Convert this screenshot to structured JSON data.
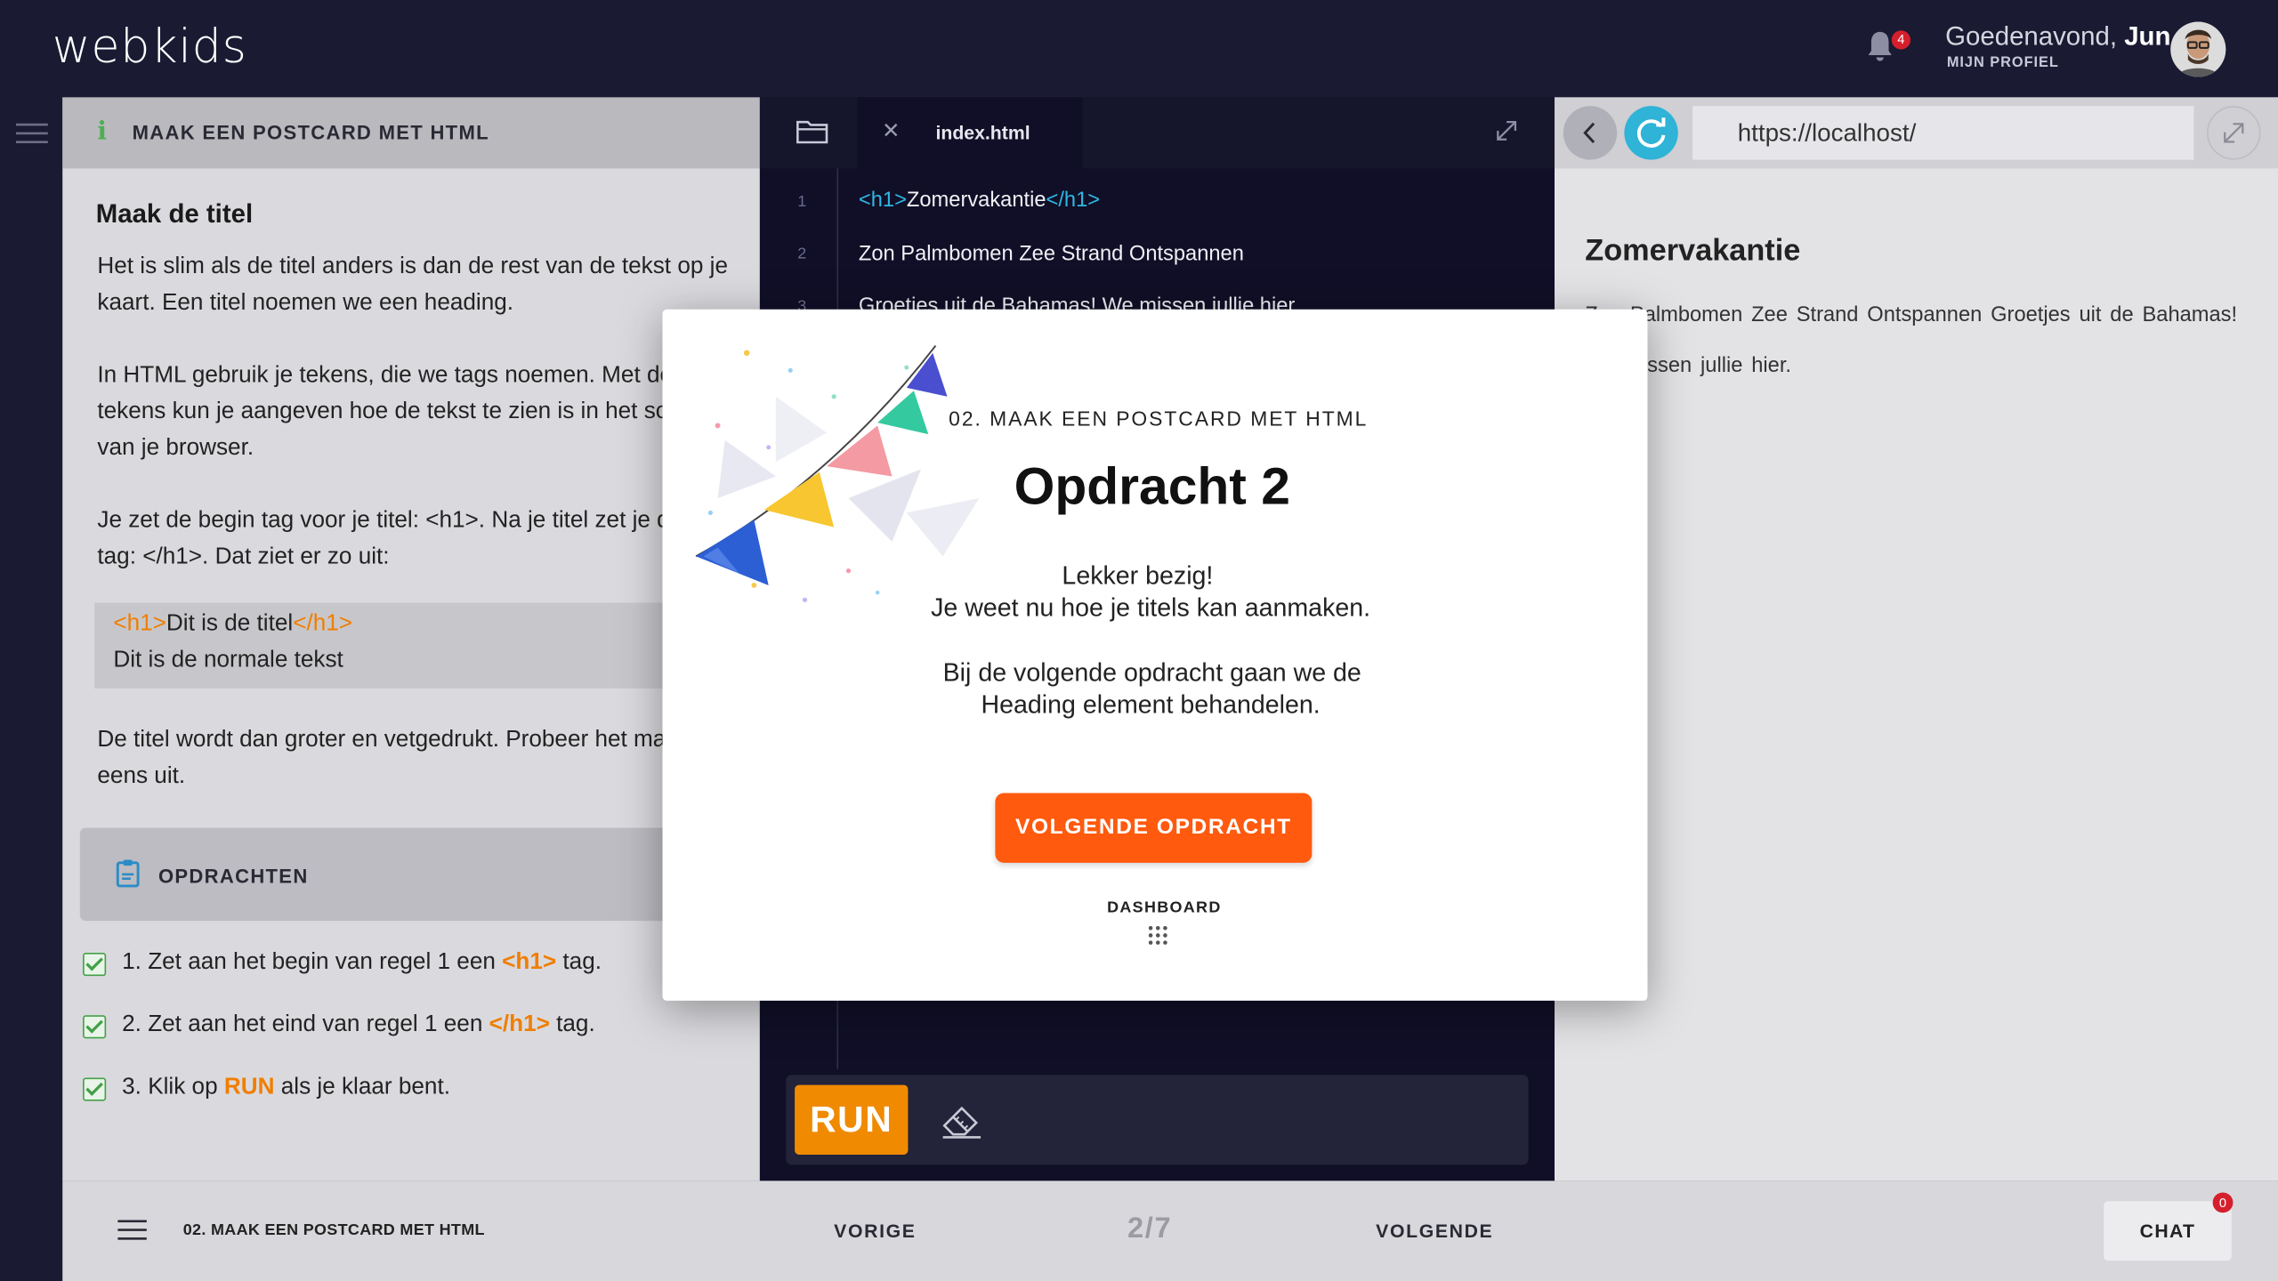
{
  "header": {
    "logo": "webkids",
    "notification_count": "4",
    "greeting_prefix": "Goedenavond,",
    "user_name": "Jun",
    "profile_link": "MIJN PROFIEL"
  },
  "lesson": {
    "title": "MAAK EEN POSTCARD MET HTML",
    "section_title": "Maak de titel",
    "para1": "Het is slim als de titel anders is dan de rest van de tekst op je kaart. Een titel noemen we een heading.",
    "para2": "In HTML gebruik je tekens, die we tags noemen. Met deze tekens kun je aangeven hoe de tekst te zien is in het scherm van je browser.",
    "para3": "Je zet de begin tag voor je titel: <h1>. Na je titel zet je de eind tag: </h1>. Dat ziet er zo uit:",
    "code": {
      "open_tag": "<h1>",
      "title_text": "Dit is de titel",
      "close_tag": "</h1>",
      "body_text": "Dit is de normale tekst"
    },
    "para4": "De titel wordt dan groter en vetgedrukt. Probeer het maar eens uit.",
    "tasks_label": "OPDRACHTEN",
    "tasks": [
      {
        "before": "1. Zet aan het begin van regel 1 een ",
        "highlight": "<h1>",
        "after": " tag."
      },
      {
        "before": "2. Zet aan het eind van regel 1 een ",
        "highlight": "</h1>",
        "after": " tag."
      },
      {
        "before": "3. Klik op ",
        "highlight": "RUN",
        "after": " als je klaar bent."
      }
    ]
  },
  "editor": {
    "tab_name": "index.html",
    "lines": [
      {
        "num": "1",
        "open": "<h1>",
        "text": "Zomervakantie",
        "close": "</h1>"
      },
      {
        "num": "2",
        "open": "",
        "text": "Zon Palmbomen Zee Strand Ontspannen",
        "close": ""
      },
      {
        "num": "3",
        "open": "",
        "text": "Groetjes uit de Bahamas! We missen jullie hier.",
        "close": ""
      }
    ],
    "run_label": "RUN"
  },
  "preview": {
    "url": "https://localhost/",
    "heading": "Zomervakantie",
    "text": "Zon Palmbomen Zee Strand Ontspannen  Groetjes uit   de Bahamas! We missen jullie hier."
  },
  "footer": {
    "title": "02. MAAK EEN POSTCARD MET HTML",
    "prev": "VORIGE",
    "counter": "2/7",
    "next": "VOLGENDE",
    "chat": "CHAT",
    "chat_count": "0"
  },
  "modal": {
    "label": "02. MAAK EEN POSTCARD MET HTML",
    "title": "Opdracht 2",
    "line1": "Lekker bezig!",
    "line2": "Je weet nu hoe je titels kan aanmaken.",
    "line3": "Bij de volgende opdracht gaan we de",
    "line4": "Heading element behandelen.",
    "button": "VOLGENDE OPDRACHT",
    "dashboard": "DASHBOARD"
  },
  "colors": {
    "topbar": "#1a1a33",
    "editor_bg": "#100f27",
    "accent_orange": "#f08a00",
    "button_orange": "#ff5a0e",
    "html_tag": "#2fb8e6",
    "reload_blue": "#2fb3d6",
    "badge_red": "#d61f2c",
    "check_green": "#43a047"
  },
  "icons": {
    "bell": "bell-icon",
    "menu": "hamburger-icon",
    "info": "info-icon",
    "tasks": "clipboard-icon",
    "folder": "folder-icon",
    "close": "close-icon",
    "expand": "expand-icon",
    "eraser": "eraser-icon",
    "back": "chevron-left-icon",
    "reload": "reload-icon",
    "dashboard": "grid-icon"
  }
}
